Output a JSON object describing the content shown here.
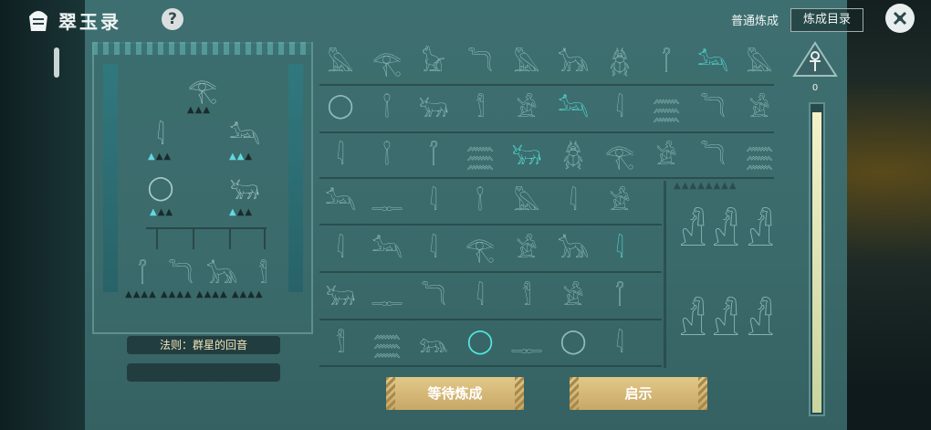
{
  "header": {
    "app_title": "翠玉录",
    "help_icon": "question-icon",
    "mode_label": "普通炼成",
    "catalog_button": "炼成目录",
    "close_icon": "close-icon"
  },
  "shrine": {
    "rule_label": "法则：群星的回音"
  },
  "meter": {
    "value": "0",
    "fill_fraction": 0.98
  },
  "buttons": {
    "wait": "等待炼成",
    "hint": "启示"
  },
  "glyph_grid": [
    [
      "bird",
      "eye",
      "cat",
      "snake",
      "bird",
      "jackal",
      "scarab",
      "crook",
      "anubis",
      "bird"
    ],
    [
      "ring",
      "staff",
      "bull",
      "mummy",
      "seated",
      "anubis",
      "reeds",
      "water",
      "snake",
      "seated"
    ],
    [
      "reeds",
      "staff",
      "crook",
      "water",
      "bull",
      "scarab",
      "eye",
      "seated",
      "snake",
      "water"
    ],
    [
      "anubis",
      "glyph",
      "reeds",
      "staff",
      "bird",
      "reeds",
      "seated"
    ],
    [
      "reeds",
      "anubis",
      "reeds",
      "eye",
      "seated",
      "jackal",
      "reeds"
    ],
    [
      "bull",
      "glyph",
      "snake",
      "reeds",
      "mummy",
      "seated",
      "crook"
    ],
    [
      "mummy",
      "water",
      "lion",
      "ring",
      "glyph",
      "ring",
      "reeds"
    ]
  ],
  "colors": {
    "panel": "#3e6f70",
    "highlight": "#55e6e0",
    "button": "#d4b676"
  }
}
